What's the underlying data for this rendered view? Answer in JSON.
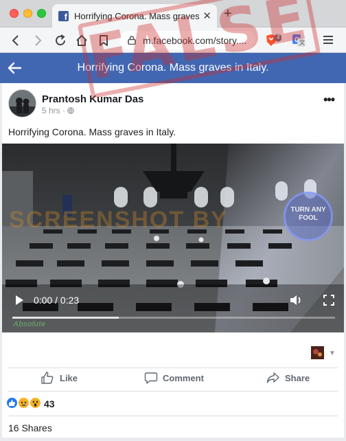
{
  "browser": {
    "tab_title": "Horrifying Corona. Mass graves in Italy.",
    "tab_close": "✕",
    "new_tab": "+",
    "url": "m.facebook.com/story....",
    "brave_badge": "2",
    "menu_icon": "hamburger-icon"
  },
  "fb": {
    "header_title": "Horrifying Corona. Mass graves in Italy.",
    "accent": "#4267b2"
  },
  "post": {
    "author": "Prantosh Kumar Das",
    "time": "5 hrs ·",
    "caption": "Horrifying Corona. Mass graves in Italy.",
    "more_label": "•••",
    "video": {
      "current_time": "0:00",
      "duration": "0:23",
      "time_text": "0:00 / 0:23",
      "buffered_fraction": 0.33,
      "overlay_watermark": "SCREENSHOT BY",
      "overlay_logo": "TURN ANY FOOL",
      "corner_logo": "Absolute"
    },
    "actions": {
      "like": "Like",
      "comment": "Comment",
      "share": "Share"
    },
    "reactions": {
      "types": [
        "like",
        "sad",
        "wow"
      ],
      "count": "43"
    },
    "shares": "16 Shares"
  },
  "stamp": {
    "text": "FALSE",
    "color": "#cd2d2d"
  }
}
